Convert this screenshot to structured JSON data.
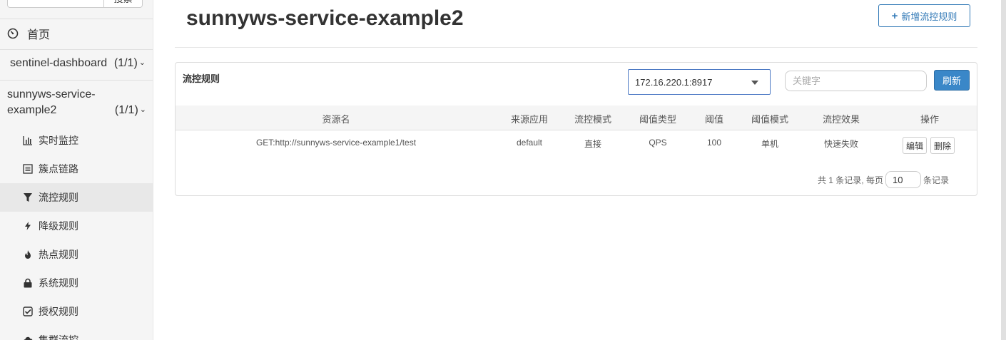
{
  "sidebar": {
    "search_button": "搜索",
    "home": "首页",
    "apps": [
      {
        "name": "sentinel-dashboard",
        "count": "(1/1)"
      },
      {
        "name_line1": "sunnyws-service-",
        "name_line2": "example2",
        "count": "(1/1)"
      }
    ],
    "menu": [
      {
        "label": "实时监控",
        "icon": "bar-chart-icon"
      },
      {
        "label": "簇点链路",
        "icon": "list-icon"
      },
      {
        "label": "流控规则",
        "icon": "filter-icon",
        "active": true
      },
      {
        "label": "降级规则",
        "icon": "flash-icon"
      },
      {
        "label": "热点规则",
        "icon": "fire-icon"
      },
      {
        "label": "系统规则",
        "icon": "lock-icon"
      },
      {
        "label": "授权规则",
        "icon": "check-icon"
      },
      {
        "label": "集群流控",
        "icon": "cloud-icon"
      }
    ]
  },
  "header": {
    "title": "sunnyws-service-example2",
    "add_button": "新增流控规则"
  },
  "panel": {
    "title": "流控规则",
    "machine": "172.16.220.1:8917",
    "keyword_placeholder": "关键字",
    "refresh": "刷新",
    "columns": [
      "资源名",
      "来源应用",
      "流控模式",
      "阈值类型",
      "阈值",
      "阈值模式",
      "流控效果",
      "操作"
    ],
    "rows": [
      {
        "resource": "GET:http://sunnyws-service-example1/test",
        "origin": "default",
        "mode": "直接",
        "grade": "QPS",
        "count": "100",
        "cluster": "单机",
        "effect": "快速失败",
        "edit": "编辑",
        "delete": "删除"
      }
    ],
    "pager": {
      "summary": "共 1 条记录, 每页",
      "page_size": "10",
      "suffix": "条记录"
    }
  },
  "colors": {
    "primary": "#337ab7",
    "refresh_bg": "#3a87c8",
    "sidebar_bg": "#f5f5f5",
    "active_bg": "#e8e8e8"
  }
}
